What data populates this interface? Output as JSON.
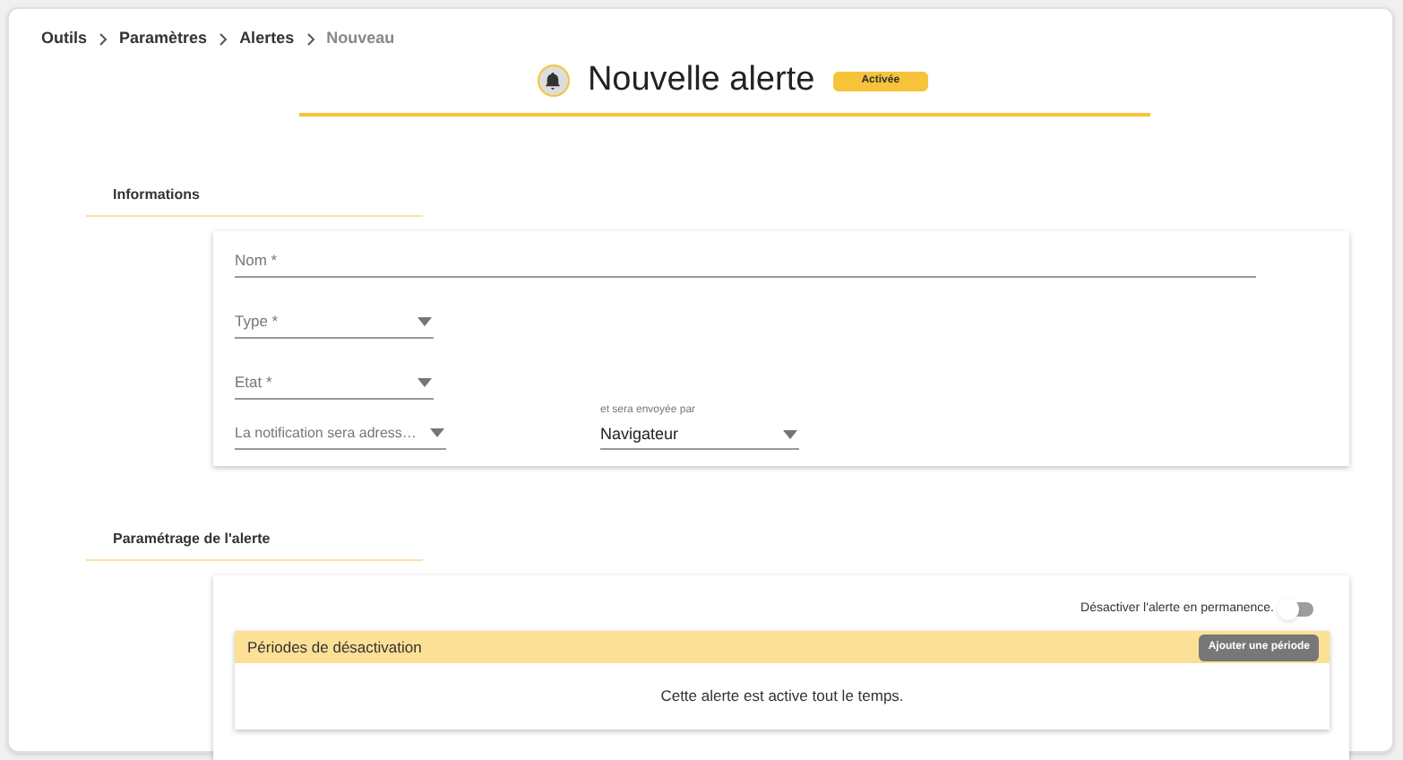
{
  "breadcrumb": [
    {
      "label": "Outils",
      "current": false
    },
    {
      "label": "Paramètres",
      "current": false
    },
    {
      "label": "Alertes",
      "current": false
    },
    {
      "label": "Nouveau",
      "current": true
    }
  ],
  "header": {
    "title": "Nouvelle alerte",
    "status": "Activée"
  },
  "informations": {
    "title": "Informations",
    "fields": [
      {
        "kind": "text",
        "placeholder": "Nom *"
      },
      {
        "kind": "select",
        "placeholder": "Type *"
      },
      {
        "kind": "select",
        "placeholder": "Etat *"
      }
    ],
    "recipient": {
      "placeholder": "La notification sera adress…"
    },
    "channel": {
      "label": "et sera envoyée par",
      "value": "Navigateur"
    }
  },
  "settings": {
    "title": "Paramétrage de l'alerte",
    "toggle": {
      "label": "Désactiver l'alerte en permanence.",
      "on": false
    },
    "periods": {
      "title": "Périodes de désactivation",
      "button": "Ajouter une période",
      "empty": "Cette alerte est active tout le temps."
    }
  }
}
